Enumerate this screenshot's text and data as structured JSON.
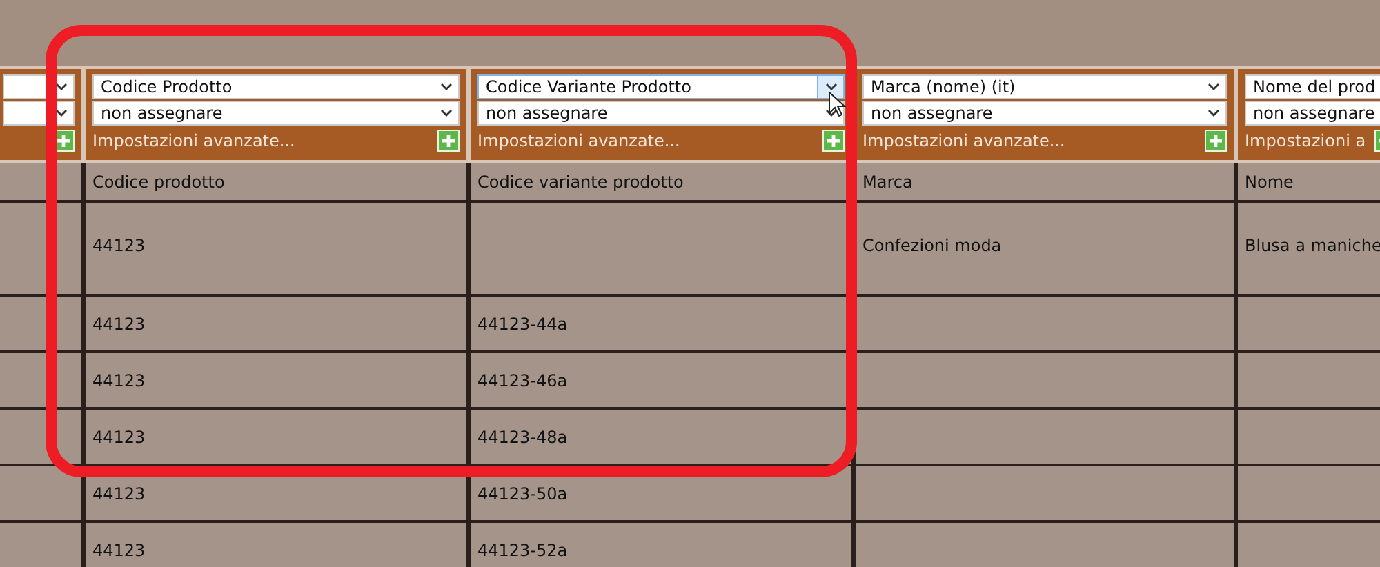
{
  "columns": [
    {
      "hovered": false
    },
    {
      "select_1": "Codice Prodotto",
      "select_2": "non assegnare",
      "advanced_link": "Impostazioni avanzate...",
      "heading": "Codice prodotto",
      "hovered": false
    },
    {
      "select_1": "Codice Variante Prodotto",
      "select_2": "non assegnare",
      "advanced_link": "Impostazioni avanzate...",
      "heading": "Codice variante prodotto",
      "hovered": true
    },
    {
      "select_1": "Marca (nome) (it)",
      "select_2": "non assegnare",
      "advanced_link": "Impostazioni avanzate...",
      "heading": "Marca",
      "hovered": false
    },
    {
      "select_1": "Nome del prod",
      "select_2": "non assegnare",
      "advanced_link": "Impostazioni a",
      "heading": "Nome",
      "hovered": false
    }
  ],
  "rows": [
    {
      "tall": true,
      "cells": [
        "",
        "44123",
        "",
        "Confezioni moda",
        "Blusa a maniche"
      ]
    },
    {
      "tall": false,
      "cells": [
        "",
        "44123",
        "44123-44a",
        "",
        ""
      ]
    },
    {
      "tall": false,
      "cells": [
        "",
        "44123",
        "44123-46a",
        "",
        ""
      ]
    },
    {
      "tall": false,
      "cells": [
        "",
        "44123",
        "44123-48a",
        "",
        ""
      ]
    },
    {
      "tall": false,
      "cells": [
        "",
        "44123",
        "44123-50a",
        "",
        ""
      ]
    },
    {
      "tall": false,
      "cells": [
        "",
        "44123",
        "44123-52a",
        "",
        ""
      ]
    }
  ],
  "highlight": {
    "shown": true
  }
}
